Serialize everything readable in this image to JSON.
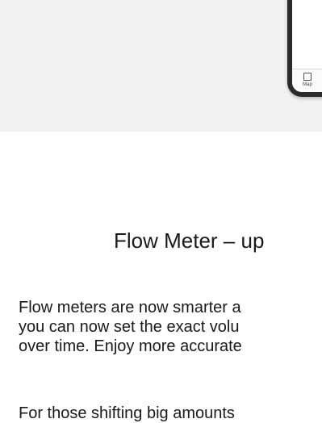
{
  "hero": {
    "phone_nav_label": "Map",
    "phone_nav_icon": "map-icon"
  },
  "article": {
    "title": "Flow Meter – up",
    "paragraph_1_lines": [
      "Flow meters are now smarter a",
      "you can now set the exact volu",
      "over time. Enjoy more accurate"
    ],
    "paragraph_2_lines": [
      "For those shifting big amounts"
    ]
  }
}
